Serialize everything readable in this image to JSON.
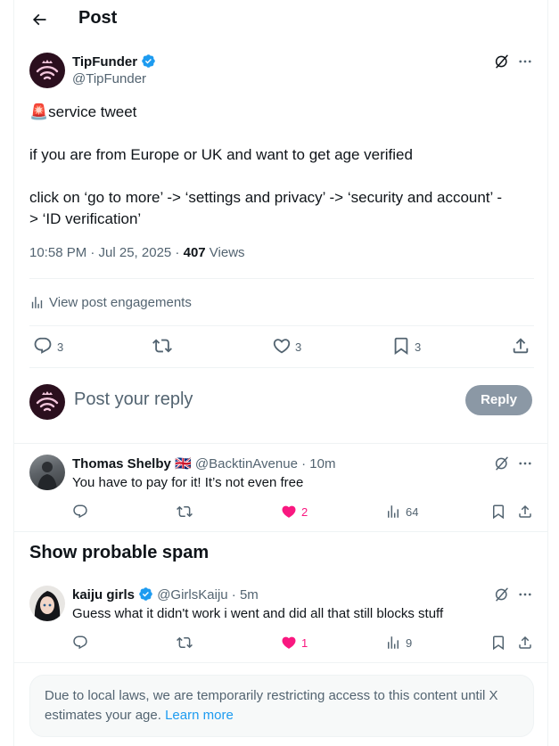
{
  "header": {
    "title": "Post"
  },
  "post": {
    "author_name": "TipFunder",
    "author_handle": "@TipFunder",
    "emoji": "🚨",
    "line1": "service tweet",
    "line2": "if you are from Europe or UK and want to get age verified",
    "line3a": "click on ‘go to more’ -> ‘settings and privacy’ -> ‘security and account’ -",
    "line3b": "> ‘ID verification’",
    "time": "10:58 PM · Jul 25, 2025 · ",
    "views_count": "407",
    "views_label": " Views",
    "engagements_label": "View post engagements",
    "replies": "3",
    "likes": "3",
    "bookmarks": "3"
  },
  "compose": {
    "placeholder": "Post your reply",
    "reply_button": "Reply"
  },
  "replies": [
    {
      "name": "Thomas Shelby",
      "flag": "🇬🇧",
      "handle": "@BacktinAvenue",
      "time": "· 10m",
      "text": "You have to pay for it! It’s not even free",
      "likes": "2",
      "views": "64"
    },
    {
      "name": "kaiju girls",
      "handle": "@GirlsKaiju",
      "time": "· 5m",
      "text": "Guess what it didn't work i went and did all that still blocks stuff",
      "likes": "1",
      "views": "9"
    }
  ],
  "spam_heading": "Show probable spam",
  "notice": {
    "text": "Due to local laws, we are temporarily restricting access to this content until X estimates your age. ",
    "link": "Learn more"
  },
  "colors": {
    "accent": "#1d9bf0",
    "like": "#f91880",
    "muted": "#536471"
  }
}
